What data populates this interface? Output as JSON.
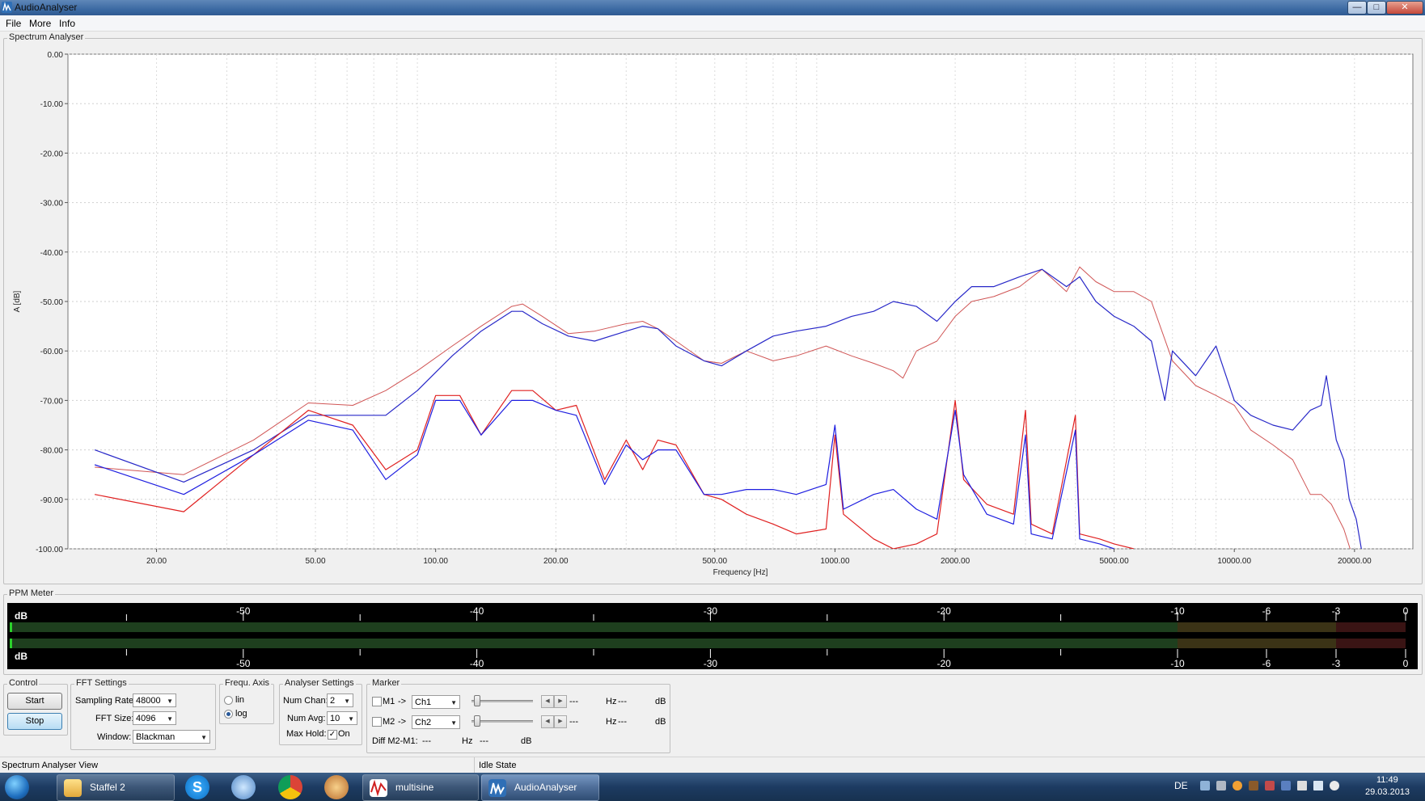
{
  "window": {
    "title": "AudioAnalyser"
  },
  "menu": [
    "File",
    "More",
    "Info"
  ],
  "spectrum_panel": {
    "label": "Spectrum Analyser"
  },
  "chart_data": {
    "type": "line",
    "xlabel": "Frequency [Hz]",
    "ylabel": "A [dB]",
    "x_scale": "log",
    "xlim": [
      12,
      28000
    ],
    "ylim": [
      -100,
      0
    ],
    "grid": true,
    "x_ticks": [
      20,
      50,
      100,
      200,
      500,
      1000,
      2000,
      5000,
      10000,
      20000
    ],
    "x_tick_labels": [
      "20.00",
      "50.00",
      "100.00",
      "200.00",
      "500.00",
      "1000.00",
      "2000.00",
      "5000.00",
      "10000.00",
      "20000.00"
    ],
    "y_ticks": [
      0,
      -10,
      -20,
      -30,
      -40,
      -50,
      -60,
      -70,
      -80,
      -90,
      -100
    ],
    "y_tick_labels": [
      "0.00",
      "-10.00",
      "-20.00",
      "-30.00",
      "-40.00",
      "-50.00",
      "-60.00",
      "-70.00",
      "-80.00",
      "-90.00",
      "-100.00"
    ],
    "series": [
      {
        "color": "#d05555",
        "width": 1,
        "points": [
          [
            14,
            -83.5
          ],
          [
            23.4,
            -85
          ],
          [
            35,
            -78
          ],
          [
            48,
            -70.5
          ],
          [
            62,
            -71
          ],
          [
            75,
            -68
          ],
          [
            90,
            -64
          ],
          [
            110,
            -59
          ],
          [
            130,
            -55
          ],
          [
            155,
            -51
          ],
          [
            165,
            -50.5
          ],
          [
            185,
            -53
          ],
          [
            215,
            -56.5
          ],
          [
            250,
            -56
          ],
          [
            300,
            -54.5
          ],
          [
            330,
            -54
          ],
          [
            360,
            -55.5
          ],
          [
            400,
            -58
          ],
          [
            470,
            -62
          ],
          [
            520,
            -62.5
          ],
          [
            600,
            -60
          ],
          [
            700,
            -62
          ],
          [
            800,
            -61
          ],
          [
            950,
            -59
          ],
          [
            1100,
            -61
          ],
          [
            1250,
            -62.5
          ],
          [
            1400,
            -64
          ],
          [
            1480,
            -65.5
          ],
          [
            1600,
            -60
          ],
          [
            1800,
            -58
          ],
          [
            2000,
            -53
          ],
          [
            2200,
            -50
          ],
          [
            2500,
            -49
          ],
          [
            2900,
            -47
          ],
          [
            3300,
            -43.5
          ],
          [
            3800,
            -48
          ],
          [
            4100,
            -43
          ],
          [
            4500,
            -46
          ],
          [
            5000,
            -48
          ],
          [
            5600,
            -48
          ],
          [
            6200,
            -50
          ],
          [
            7000,
            -62
          ],
          [
            8000,
            -67
          ],
          [
            9000,
            -69
          ],
          [
            10000,
            -71
          ],
          [
            11000,
            -76
          ],
          [
            12500,
            -79
          ],
          [
            14000,
            -82
          ],
          [
            15500,
            -89
          ],
          [
            16500,
            -89
          ],
          [
            17500,
            -91
          ],
          [
            18800,
            -96
          ],
          [
            19500,
            -100
          ]
        ]
      },
      {
        "color": "#2828c8",
        "width": 1.2,
        "points": [
          [
            14,
            -80
          ],
          [
            23.4,
            -86.5
          ],
          [
            35,
            -80
          ],
          [
            48,
            -73
          ],
          [
            62,
            -73
          ],
          [
            75,
            -73
          ],
          [
            90,
            -68
          ],
          [
            110,
            -61
          ],
          [
            130,
            -56
          ],
          [
            155,
            -52
          ],
          [
            165,
            -52
          ],
          [
            185,
            -54.5
          ],
          [
            215,
            -57
          ],
          [
            250,
            -58
          ],
          [
            300,
            -56
          ],
          [
            330,
            -55
          ],
          [
            360,
            -55.5
          ],
          [
            400,
            -59
          ],
          [
            470,
            -62
          ],
          [
            520,
            -63
          ],
          [
            600,
            -60
          ],
          [
            700,
            -57
          ],
          [
            800,
            -56
          ],
          [
            950,
            -55
          ],
          [
            1100,
            -53
          ],
          [
            1250,
            -52
          ],
          [
            1400,
            -50
          ],
          [
            1600,
            -51
          ],
          [
            1800,
            -54
          ],
          [
            2000,
            -50
          ],
          [
            2200,
            -47
          ],
          [
            2500,
            -47
          ],
          [
            2900,
            -45
          ],
          [
            3300,
            -43.5
          ],
          [
            3800,
            -47
          ],
          [
            4100,
            -45
          ],
          [
            4500,
            -50
          ],
          [
            5000,
            -53
          ],
          [
            5600,
            -55
          ],
          [
            6200,
            -58
          ],
          [
            6700,
            -70
          ],
          [
            7000,
            -60
          ],
          [
            8000,
            -65
          ],
          [
            9000,
            -59
          ],
          [
            10000,
            -70
          ],
          [
            11000,
            -73
          ],
          [
            12500,
            -75
          ],
          [
            14000,
            -76
          ],
          [
            15500,
            -72
          ],
          [
            16500,
            -71
          ],
          [
            17000,
            -65
          ],
          [
            18000,
            -78
          ],
          [
            18800,
            -82
          ],
          [
            19400,
            -90
          ],
          [
            20200,
            -94
          ],
          [
            20800,
            -100
          ]
        ]
      },
      {
        "color": "#e02020",
        "width": 1.2,
        "points": [
          [
            14,
            -89
          ],
          [
            23.4,
            -92.5
          ],
          [
            35,
            -81
          ],
          [
            48,
            -72
          ],
          [
            62,
            -75
          ],
          [
            75,
            -84
          ],
          [
            90,
            -80
          ],
          [
            100,
            -69
          ],
          [
            115,
            -69
          ],
          [
            130,
            -77
          ],
          [
            155,
            -68
          ],
          [
            175,
            -68
          ],
          [
            200,
            -72
          ],
          [
            225,
            -71
          ],
          [
            265,
            -86
          ],
          [
            300,
            -78
          ],
          [
            330,
            -84
          ],
          [
            360,
            -78
          ],
          [
            400,
            -79
          ],
          [
            470,
            -89
          ],
          [
            520,
            -90
          ],
          [
            600,
            -93
          ],
          [
            700,
            -95
          ],
          [
            800,
            -97
          ],
          [
            950,
            -96
          ],
          [
            1000,
            -77
          ],
          [
            1050,
            -93
          ],
          [
            1250,
            -98
          ],
          [
            1400,
            -100
          ],
          [
            1600,
            -99
          ],
          [
            1800,
            -97
          ],
          [
            2000,
            -70
          ],
          [
            2100,
            -86
          ],
          [
            2400,
            -91
          ],
          [
            2800,
            -93
          ],
          [
            3000,
            -72
          ],
          [
            3100,
            -95
          ],
          [
            3500,
            -97
          ],
          [
            4000,
            -73
          ],
          [
            4100,
            -97
          ],
          [
            4600,
            -98
          ],
          [
            5000,
            -99
          ],
          [
            5600,
            -100
          ]
        ]
      },
      {
        "color": "#1e1ee0",
        "width": 1.2,
        "points": [
          [
            14,
            -83
          ],
          [
            23.4,
            -89
          ],
          [
            35,
            -81
          ],
          [
            48,
            -74
          ],
          [
            62,
            -76
          ],
          [
            75,
            -86
          ],
          [
            90,
            -81
          ],
          [
            100,
            -70
          ],
          [
            115,
            -70
          ],
          [
            130,
            -77
          ],
          [
            155,
            -70
          ],
          [
            175,
            -70
          ],
          [
            200,
            -72
          ],
          [
            225,
            -73
          ],
          [
            265,
            -87
          ],
          [
            300,
            -79
          ],
          [
            330,
            -82
          ],
          [
            360,
            -80
          ],
          [
            400,
            -80
          ],
          [
            470,
            -89
          ],
          [
            520,
            -89
          ],
          [
            600,
            -88
          ],
          [
            700,
            -88
          ],
          [
            800,
            -89
          ],
          [
            950,
            -87
          ],
          [
            1000,
            -75
          ],
          [
            1050,
            -92
          ],
          [
            1250,
            -89
          ],
          [
            1400,
            -88
          ],
          [
            1600,
            -92
          ],
          [
            1800,
            -94
          ],
          [
            2000,
            -72
          ],
          [
            2100,
            -85
          ],
          [
            2400,
            -93
          ],
          [
            2800,
            -95
          ],
          [
            3000,
            -77
          ],
          [
            3100,
            -97
          ],
          [
            3500,
            -98
          ],
          [
            4000,
            -76
          ],
          [
            4100,
            -98
          ],
          [
            4600,
            -99
          ],
          [
            5000,
            -100
          ]
        ]
      }
    ]
  },
  "ppm": {
    "label": "PPM Meter",
    "unit": "dB",
    "ticks": [
      -50,
      -40,
      -30,
      -20,
      -10,
      -6,
      -3,
      0
    ],
    "tick_labels": [
      "-50",
      "-40",
      "-30",
      "-20",
      "-10",
      "-6",
      "-3",
      "0"
    ]
  },
  "control": {
    "label": "Control",
    "start": "Start",
    "stop": "Stop"
  },
  "fft": {
    "label": "FFT Settings",
    "sampling_rate_label": "Sampling Rate:",
    "sampling_rate": "48000",
    "fft_size_label": "FFT Size:",
    "fft_size": "4096",
    "window_label": "Window:",
    "window": "Blackman"
  },
  "axis": {
    "label": "Frequ. Axis",
    "lin": "lin",
    "log": "log",
    "selected": "log"
  },
  "analyser": {
    "label": "Analyser Settings",
    "num_chan_label": "Num Chan:",
    "num_chan": "2",
    "num_avg_label": "Num Avg:",
    "num_avg": "10",
    "max_hold_label": "Max Hold:",
    "max_hold_on": "On"
  },
  "marker": {
    "label": "Marker",
    "m1": "M1",
    "m2": "M2",
    "arrow": "->",
    "ch1": "Ch1",
    "ch2": "Ch2",
    "dashes": "---",
    "hz": "Hz",
    "db": "dB",
    "diff": "Diff M2-M1:"
  },
  "status": {
    "left": "Spectrum Analyser View",
    "right": "Idle State"
  },
  "taskbar": {
    "items": [
      "Staffel 2",
      "multisine",
      "AudioAnalyser"
    ],
    "lang": "DE",
    "time": "11:49",
    "date": "29.03.2013"
  },
  "colors": {
    "plot_red": "#d05555",
    "plot_blue": "#2828c8",
    "meter_green": "#1e3f1e",
    "meter_yellow": "#3b3316",
    "meter_red": "#3a1414"
  }
}
